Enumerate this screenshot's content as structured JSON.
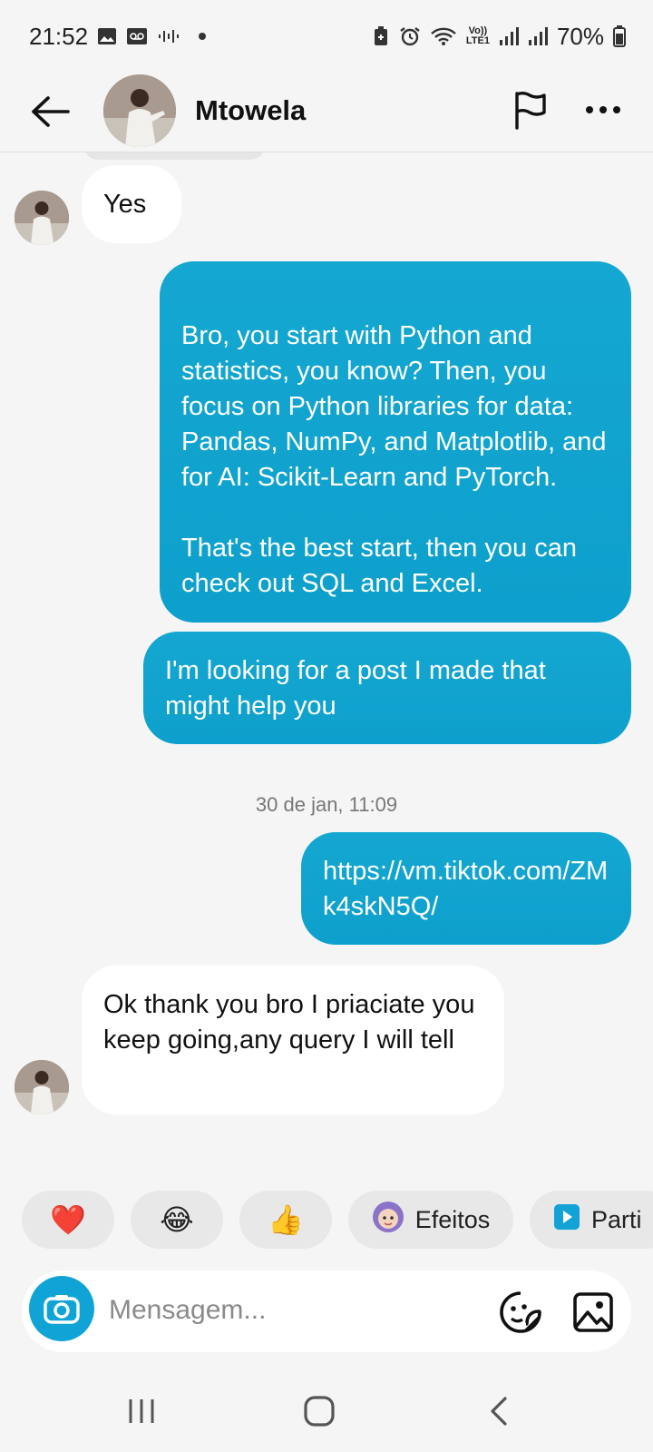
{
  "status_bar": {
    "time": "21:52",
    "battery": "70%",
    "network": "LTE1",
    "icons_left": [
      "gallery-icon",
      "voicemail-icon",
      "audio-icon"
    ],
    "icons_right": [
      "battery-saver-icon",
      "alarm-icon",
      "wifi-icon",
      "volte-icon",
      "signal-icon",
      "signal-icon",
      "battery-icon"
    ]
  },
  "header": {
    "contact_name": "Mtowela",
    "icons": [
      "back-arrow-icon",
      "flag-icon",
      "more-icon"
    ]
  },
  "messages": [
    {
      "direction": "incoming",
      "text": "Yes"
    },
    {
      "direction": "outgoing",
      "text": "Bro, you start with Python and statistics, you know? Then, you focus on Python libraries for data: Pandas, NumPy, and Matplotlib, and for AI: Scikit-Learn and PyTorch.\n\nThat's the best start, then you can check out SQL and Excel."
    },
    {
      "direction": "outgoing",
      "text": "I'm looking for a post I made that might help you"
    },
    {
      "direction": "timestamp",
      "text": "30 de jan, 11:09"
    },
    {
      "direction": "outgoing",
      "text": "https://vm.tiktok.com/ZMk4skN5Q/"
    },
    {
      "direction": "incoming",
      "text": "Ok thank you bro I priaciate you keep going,any query I will tell"
    }
  ],
  "quick_reactions": [
    {
      "type": "emoji",
      "glyph": "❤️",
      "icon": "heart-icon"
    },
    {
      "type": "emoji",
      "glyph": "😂",
      "icon": "laughing-emoji-icon"
    },
    {
      "type": "emoji",
      "glyph": "👍",
      "icon": "thumbs-up-icon"
    },
    {
      "type": "chip",
      "label": "Efeitos",
      "icon": "effects-avatar-icon"
    },
    {
      "type": "chip",
      "label": "Parti",
      "icon": "play-square-icon"
    }
  ],
  "composer": {
    "placeholder": "Mensagem...",
    "icons": [
      "camera-icon",
      "sticker-icon",
      "gallery-icon"
    ]
  },
  "nav_bar": {
    "icons": [
      "recent-apps-icon",
      "home-icon",
      "back-icon"
    ]
  },
  "colors": {
    "outgoing_bubble": "#13a3cf",
    "incoming_bubble": "#ffffff",
    "background": "#f5f5f5",
    "camera_button": "#10a4d6",
    "chip_background": "#e8e8e8"
  }
}
